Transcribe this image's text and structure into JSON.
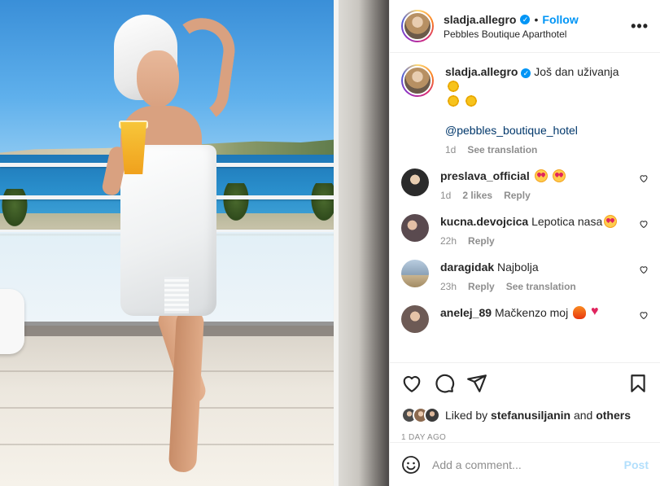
{
  "post": {
    "username": "sladja.allegro",
    "location": "Pebbles Boutique Aparthotel",
    "follow_label": "Follow",
    "separator": "•",
    "more_label": "•••"
  },
  "caption": {
    "username": "sladja.allegro",
    "text": "Još dan uživanja",
    "mention": "@pebbles_boutique_hotel",
    "time": "1d",
    "see_translation": "See translation"
  },
  "comments": [
    {
      "username": "preslava_official",
      "text": "",
      "time": "1d",
      "likes": "2 likes",
      "reply": "Reply",
      "avatar_color": "#2b2b2b"
    },
    {
      "username": "kucna.devojcica",
      "text": "Lepotica nasa",
      "time": "22h",
      "reply": "Reply",
      "avatar_color": "#5a4a4f"
    },
    {
      "username": "daragidak",
      "text": "Najbolja",
      "time": "23h",
      "reply": "Reply",
      "see_translation": "See translation",
      "avatar_color": "#8aa1b7"
    },
    {
      "username": "anelej_89",
      "text": "Mačkenzo moj",
      "avatar_color": "#6d5a55"
    }
  ],
  "actions": {
    "icons": [
      "heart-icon",
      "comment-icon",
      "share-icon",
      "bookmark-icon"
    ],
    "liked_prefix": "Liked by",
    "liked_user": "stefanusiljanin",
    "liked_and": "and",
    "liked_others": "others",
    "ago": "1 DAY AGO"
  },
  "add_comment": {
    "placeholder": "Add a comment...",
    "post_label": "Post",
    "icon": "emoji-icon"
  },
  "colors": {
    "accent": "#0095f6",
    "post_disabled": "#b2dffc",
    "muted": "#8e8e8e"
  }
}
